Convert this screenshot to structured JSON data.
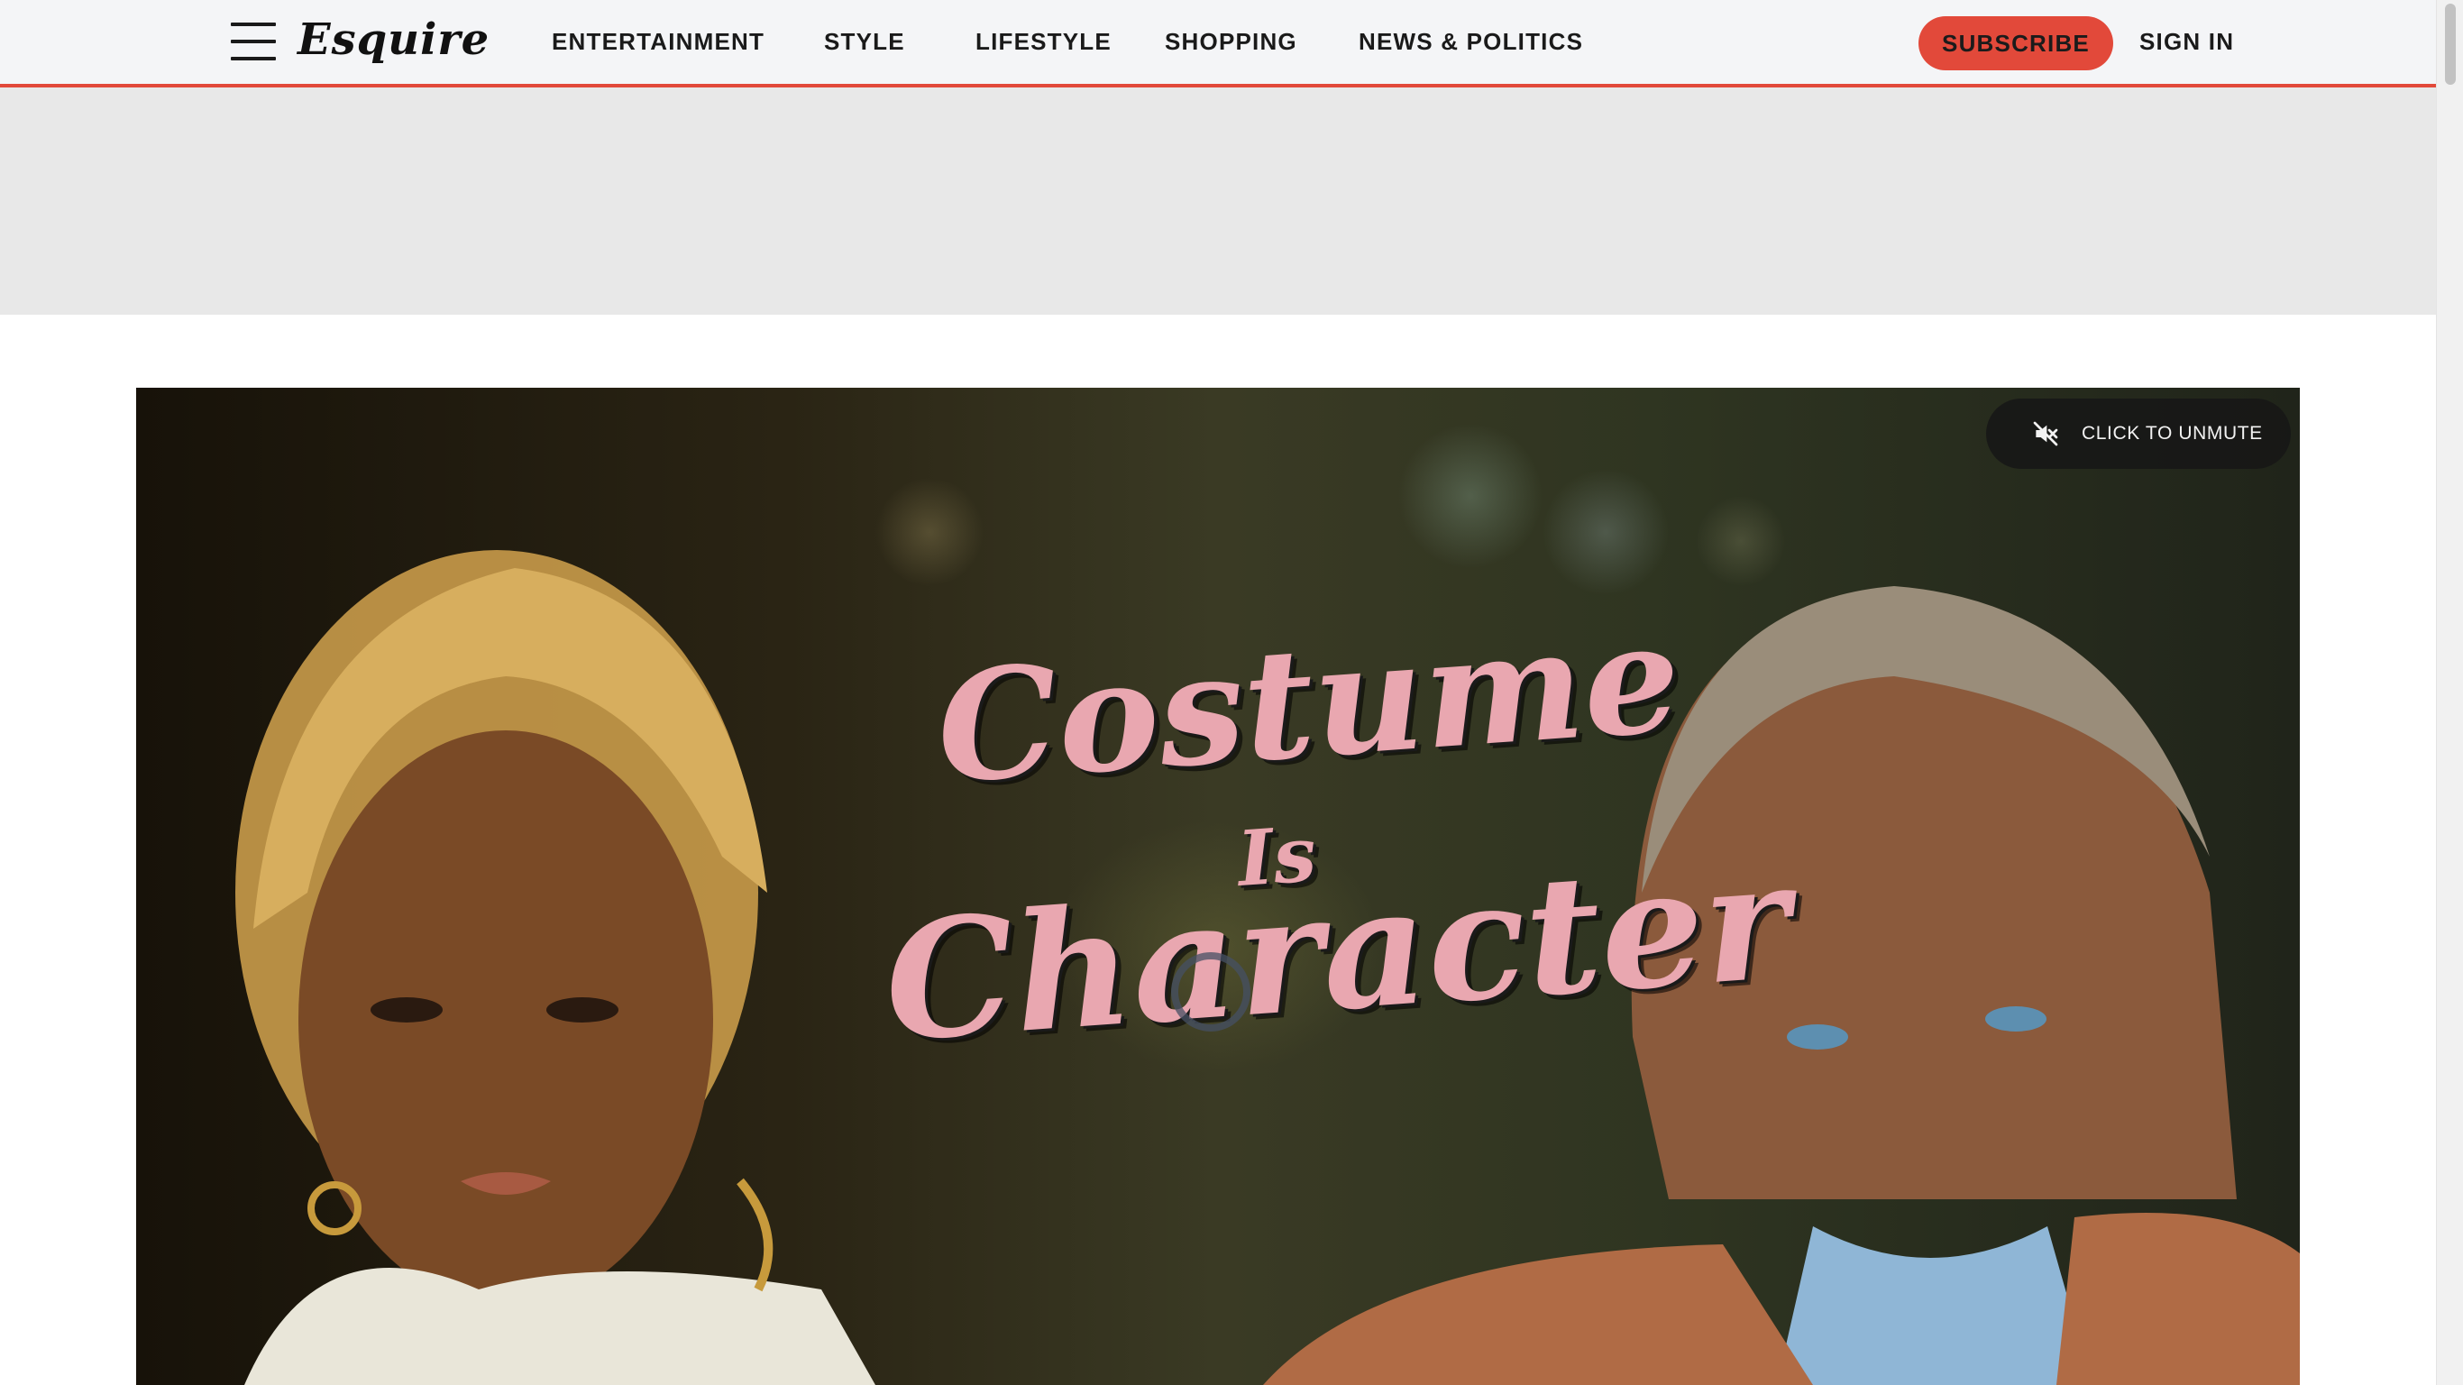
{
  "header": {
    "logo_text": "Esquire",
    "nav": [
      {
        "label": "ENTERTAINMENT"
      },
      {
        "label": "STYLE"
      },
      {
        "label": "LIFESTYLE"
      },
      {
        "label": "SHOPPING"
      },
      {
        "label": "NEWS & POLITICS"
      }
    ],
    "subscribe_label": "SUBSCRIBE",
    "signin_label": "SIGN IN"
  },
  "video": {
    "unmute_label": "CLICK TO UNMUTE",
    "title_line1": "Costume",
    "title_line2": "Is",
    "title_line3": "Character",
    "player_state": "loading"
  },
  "icons": {
    "menu": "hamburger-menu-icon",
    "mute": "speaker-muted-icon",
    "loading": "loading-spinner-icon"
  },
  "colors": {
    "accent": "#e2493a",
    "header_bg": "#f4f5f7",
    "ad_bg": "#e8e8e8",
    "title_pink": "#e9a7b0"
  }
}
